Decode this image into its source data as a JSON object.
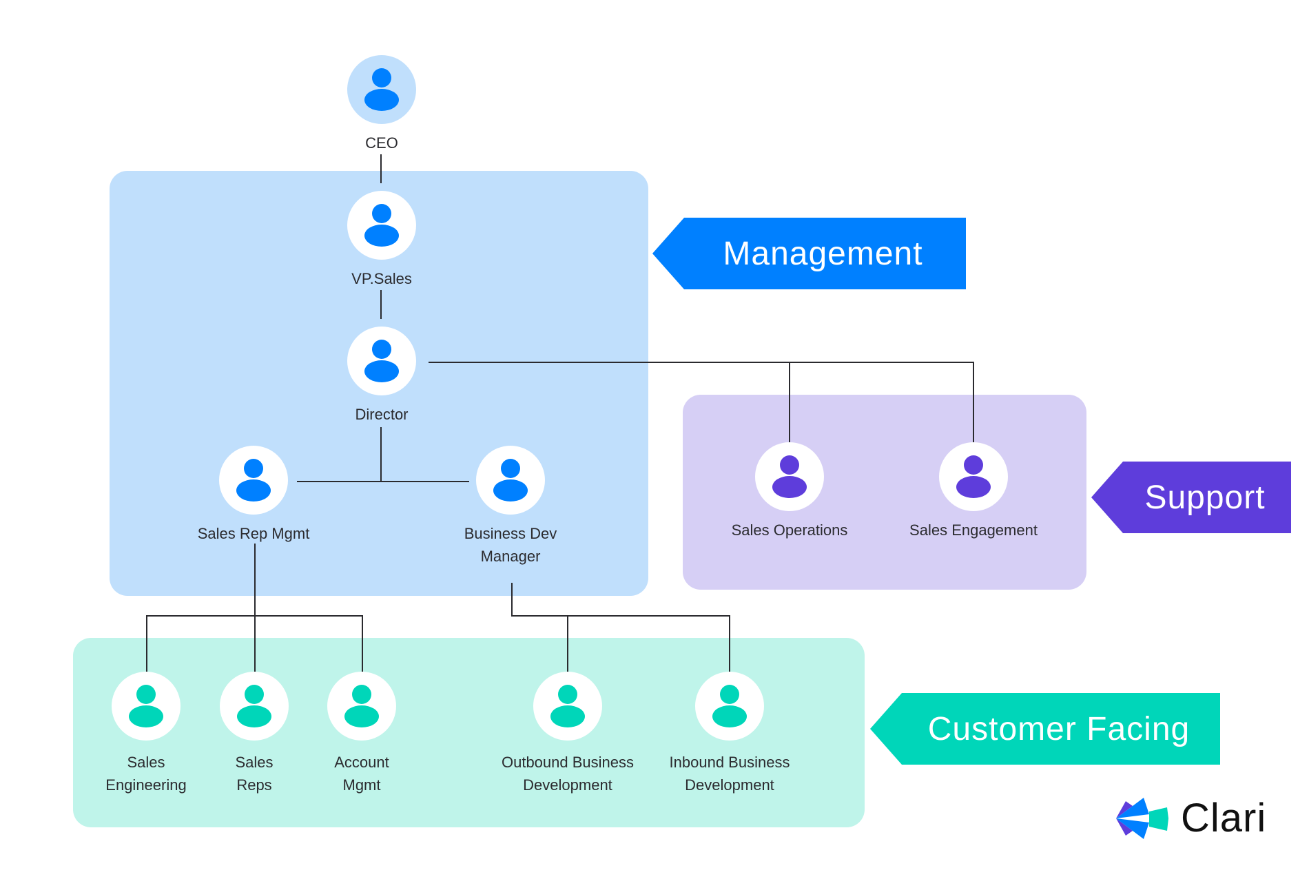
{
  "colors": {
    "management_bg": "#c0dffc",
    "management_accent": "#0080ff",
    "support_bg": "#d6cff5",
    "support_accent": "#5e3ddb",
    "customer_bg": "#bff4ea",
    "customer_accent": "#00d6b9",
    "connector": "#2a2a2e"
  },
  "groups": {
    "management": {
      "tag": "Management"
    },
    "support": {
      "tag": "Support"
    },
    "customer_facing": {
      "tag": "Customer Facing"
    }
  },
  "nodes": {
    "ceo": {
      "label": "CEO",
      "group": "none"
    },
    "vp_sales": {
      "label": "VP.Sales",
      "group": "management"
    },
    "director": {
      "label": "Director",
      "group": "management"
    },
    "sales_rep_mgmt": {
      "label": "Sales Rep Mgmt",
      "group": "management"
    },
    "business_dev_manager": {
      "label_line1": "Business Dev",
      "label_line2": "Manager",
      "group": "management"
    },
    "sales_operations": {
      "label": "Sales Operations",
      "group": "support"
    },
    "sales_engagement": {
      "label": "Sales Engagement",
      "group": "support"
    },
    "sales_engineering": {
      "label_line1": "Sales",
      "label_line2": "Engineering",
      "group": "customer_facing"
    },
    "sales_reps": {
      "label_line1": "Sales",
      "label_line2": "Reps",
      "group": "customer_facing"
    },
    "account_mgmt": {
      "label_line1": "Account",
      "label_line2": "Mgmt",
      "group": "customer_facing"
    },
    "outbound_bd": {
      "label_line1": "Outbound Business",
      "label_line2": "Development",
      "group": "customer_facing"
    },
    "inbound_bd": {
      "label_line1": "Inbound Business",
      "label_line2": "Development",
      "group": "customer_facing"
    }
  },
  "edges": [
    [
      "CEO",
      "VP.Sales"
    ],
    [
      "VP.Sales",
      "Director"
    ],
    [
      "Director",
      "Sales Rep Mgmt"
    ],
    [
      "Director",
      "Business Dev Manager"
    ],
    [
      "Director",
      "Sales Operations"
    ],
    [
      "Director",
      "Sales Engagement"
    ],
    [
      "Sales Rep Mgmt",
      "Sales Engineering"
    ],
    [
      "Sales Rep Mgmt",
      "Sales Reps"
    ],
    [
      "Sales Rep Mgmt",
      "Account Mgmt"
    ],
    [
      "Business Dev Manager",
      "Outbound Business Development"
    ],
    [
      "Business Dev Manager",
      "Inbound Business Development"
    ]
  ],
  "brand": {
    "name": "Clari",
    "icon": "clari-logo-icon"
  }
}
